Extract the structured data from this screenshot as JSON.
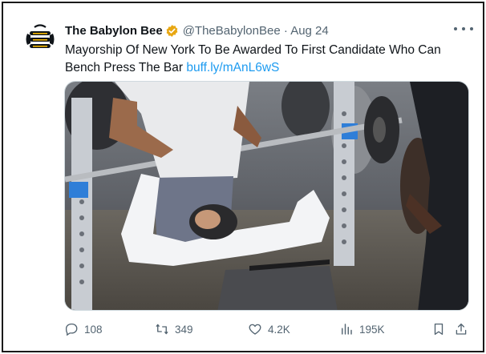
{
  "tweet": {
    "author_name": "The Babylon Bee",
    "handle": "@TheBabylonBee",
    "separator": "·",
    "date": "Aug 24",
    "text": "Mayorship Of New York To Be Awarded To First Candidate Who Can Bench Press The Bar",
    "link": "buff.ly/mAnL6wS",
    "media_alt": "Man in white shirt bench pressing a bar in an outdoor gym while another man spots him and a crowd watches"
  },
  "actions": {
    "replies": "108",
    "retweets": "349",
    "likes": "4.2K",
    "views": "195K"
  },
  "colors": {
    "link": "#1d9bf0",
    "verified": "#e8a712",
    "secondary_text": "#536471",
    "logo_yellow": "#f5b800"
  }
}
